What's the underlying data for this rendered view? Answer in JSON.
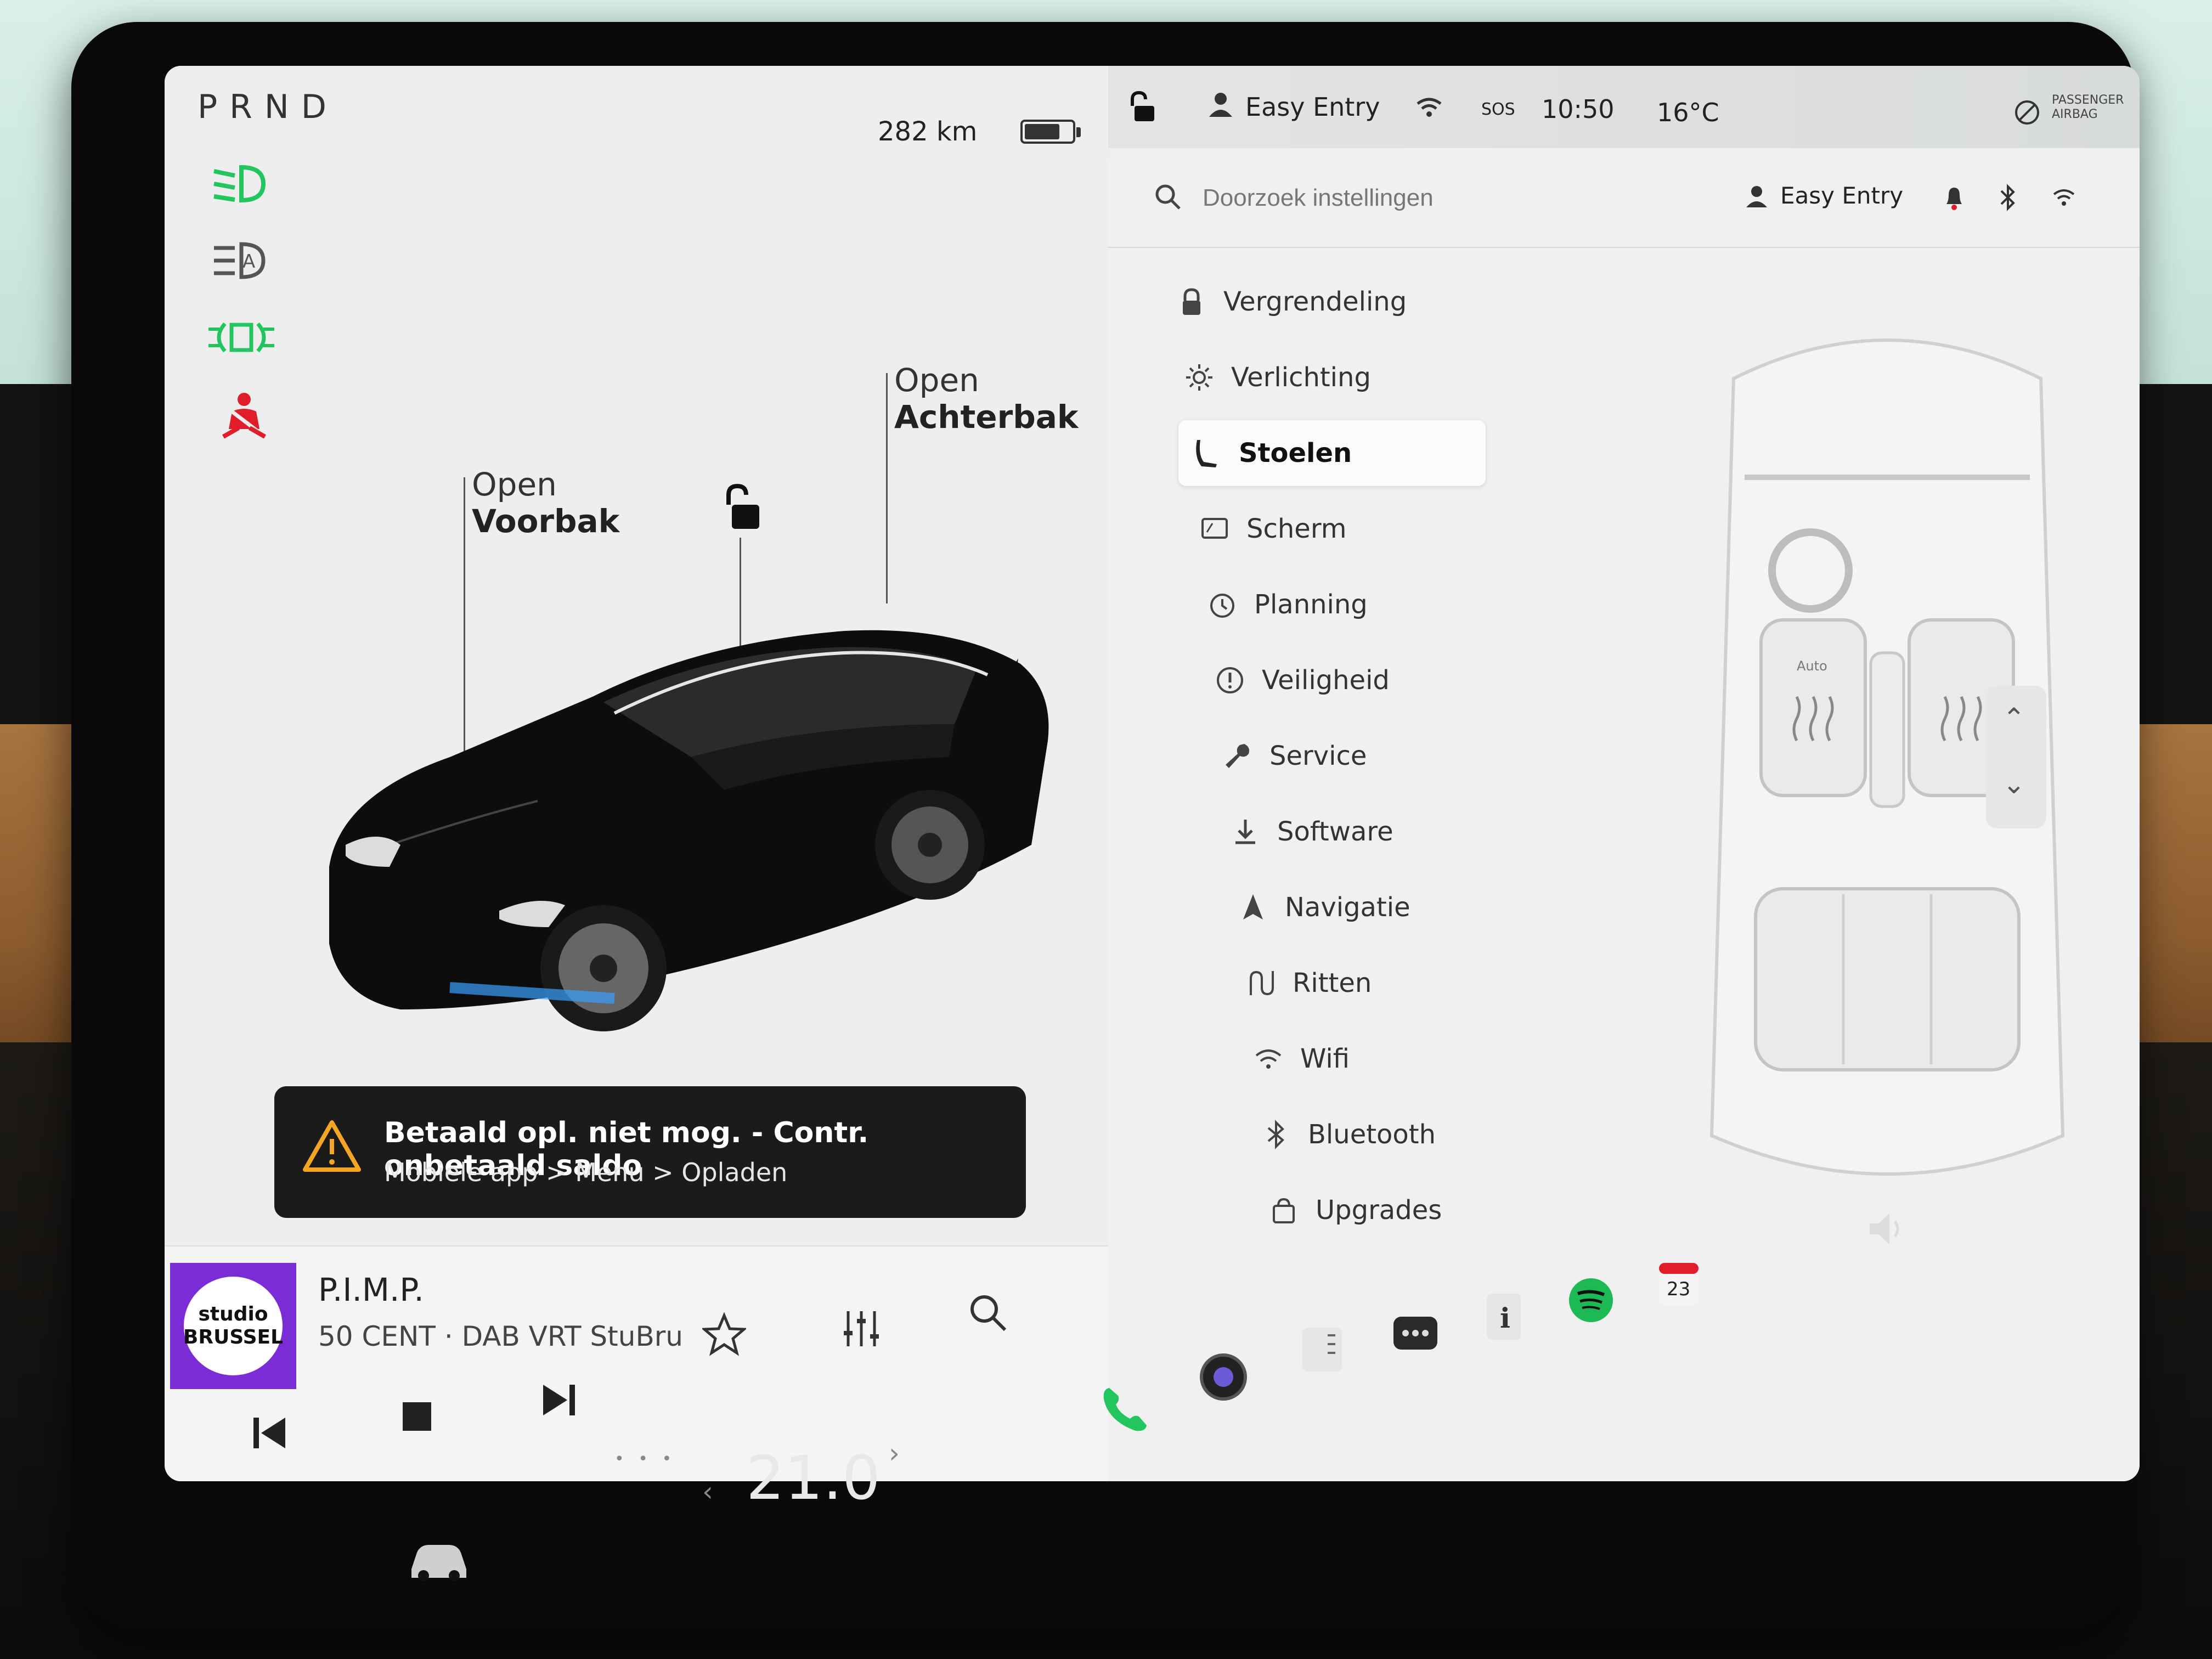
{
  "gear": "PRND",
  "status": {
    "range": "282 km",
    "battery_level": 0.75
  },
  "car_labels": {
    "frunk_open": "Open",
    "frunk": "Voorbak",
    "trunk_open": "Open",
    "trunk": "Achterbak"
  },
  "notice": {
    "title": "Betaald opl. niet mog. - Contr. onbetaald saldo",
    "subtitle": "Mobiele app > Menu > Opladen"
  },
  "media": {
    "art_text": "studio BRUSSEL",
    "song": "P.I.M.P.",
    "artist": "50 CENT · DAB VRT StuBru",
    "dots": "• • •"
  },
  "topbar": {
    "profile": "Easy Entry",
    "sos": "SOS",
    "time": "10:50",
    "temperature": "16°C",
    "airbag": "PASSENGER AIRBAG"
  },
  "settings": {
    "search_placeholder": "Doorzoek instellingen",
    "profile": "Easy Entry",
    "menu": [
      {
        "label": "Vergrendeling",
        "icon": "lock-icon"
      },
      {
        "label": "Verlichting",
        "icon": "light-icon"
      },
      {
        "label": "Stoelen",
        "icon": "seat-icon",
        "selected": true
      },
      {
        "label": "Scherm",
        "icon": "display-icon"
      },
      {
        "label": "Planning",
        "icon": "schedule-icon"
      },
      {
        "label": "Veiligheid",
        "icon": "safety-icon"
      },
      {
        "label": "Service",
        "icon": "wrench-icon"
      },
      {
        "label": "Software",
        "icon": "download-icon"
      },
      {
        "label": "Navigatie",
        "icon": "navigation-icon"
      },
      {
        "label": "Ritten",
        "icon": "trips-icon"
      },
      {
        "label": "Wifi",
        "icon": "wifi-icon"
      },
      {
        "label": "Bluetooth",
        "icon": "bluetooth-icon"
      },
      {
        "label": "Upgrades",
        "icon": "bag-icon"
      }
    ],
    "seat_label": "Auto"
  },
  "dock": {
    "cabin_temp": "21.0",
    "calendar_day": "23"
  },
  "colors": {
    "indicator_green": "#22c55e",
    "seatbelt_red": "#e11d2a",
    "spotify_green": "#1db954",
    "phone_green": "#22c55e",
    "album_purple": "#7b2cd6"
  }
}
